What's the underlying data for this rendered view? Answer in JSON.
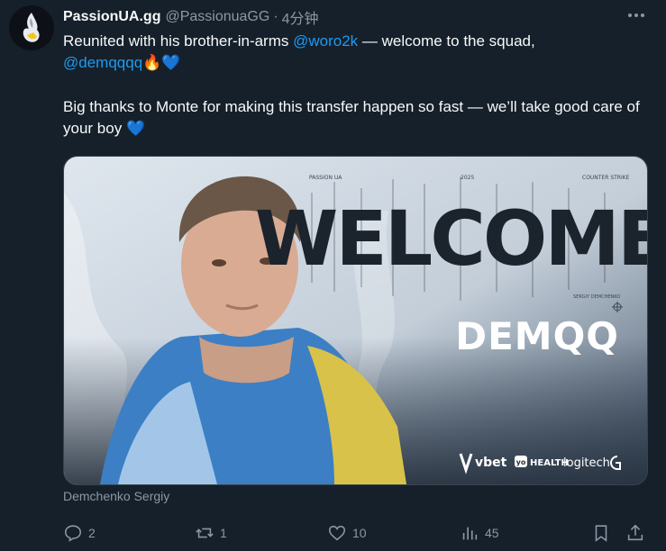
{
  "tweet": {
    "display_name": "PassionUA.gg",
    "handle": "@PassionuaGG",
    "separator": "·",
    "time": "4分钟",
    "line1_before": "Reunited with his brother-in-arms ",
    "mention1": "@woro2k",
    "line1_after": " — welcome to the squad,",
    "mention2": "@demqqqq",
    "emoji_fire": "🔥",
    "emoji_heart": "💙",
    "para2": "Big thanks to Monte for making this transfer happen so fast — we’ll take good care of your boy ",
    "emoji_heart2": "💙"
  },
  "media": {
    "headline": "WELCOME",
    "player_tag": "DEMQQ",
    "small_left": "PASSION UA",
    "small_mid": "2025",
    "small_right": "COUNTER STRIKE",
    "small_name": "SERGIY DEMCHENKO",
    "sponsor1": "vbet",
    "sponsor2_badge": "yo",
    "sponsor2": "HEALTH",
    "sponsor3": "logitech"
  },
  "caption": "Demchenko Sergiy",
  "actions": {
    "replies": "2",
    "reposts": "1",
    "likes": "10",
    "views": "45"
  },
  "colors": {
    "background": "#15202b",
    "text": "#f7f9f9",
    "secondary": "#8b98a5",
    "link": "#1d9bf0"
  },
  "icons": [
    "more-icon",
    "reply-icon",
    "repost-icon",
    "like-icon",
    "views-icon",
    "bookmark-icon",
    "share-icon"
  ]
}
